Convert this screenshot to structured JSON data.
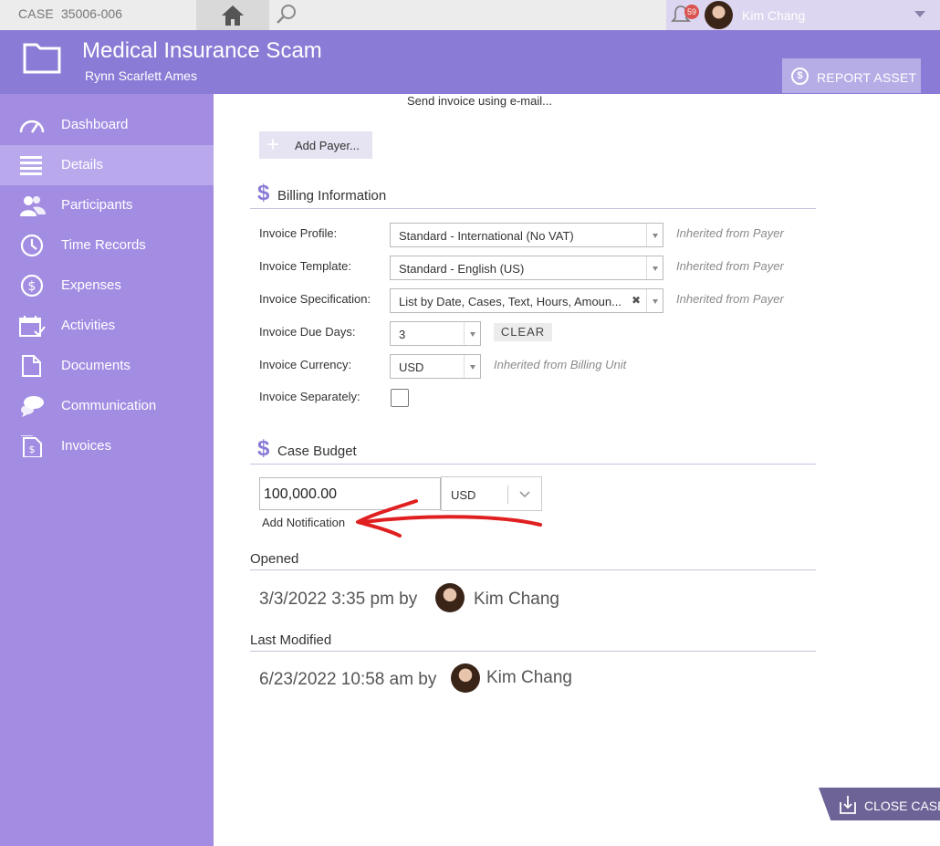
{
  "topbar": {
    "case_label": "CASE",
    "case_number": "35006-006",
    "notification_count": "59",
    "user_name": "Kim Chang"
  },
  "header": {
    "title": "Medical Insurance Scam",
    "subtitle": "Rynn Scarlett Ames",
    "report_asset_label": "REPORT ASSET"
  },
  "sidebar": {
    "items": [
      {
        "label": "Dashboard",
        "icon": "gauge-icon"
      },
      {
        "label": "Details",
        "icon": "list-icon",
        "active": true
      },
      {
        "label": "Participants",
        "icon": "people-icon"
      },
      {
        "label": "Time Records",
        "icon": "clock-icon"
      },
      {
        "label": "Expenses",
        "icon": "dollar-circle-icon"
      },
      {
        "label": "Activities",
        "icon": "calendar-icon"
      },
      {
        "label": "Documents",
        "icon": "document-icon"
      },
      {
        "label": "Communication",
        "icon": "chat-icon"
      },
      {
        "label": "Invoices",
        "icon": "invoice-icon"
      }
    ]
  },
  "content": {
    "send_invoice": "Send invoice using e-mail...",
    "add_payer": "Add Payer...",
    "billing": {
      "title": "Billing Information",
      "invoice_profile_label": "Invoice Profile:",
      "invoice_profile_value": "Standard - International (No VAT)",
      "invoice_profile_hint": "Inherited from Payer",
      "invoice_template_label": "Invoice Template:",
      "invoice_template_value": "Standard - English (US)",
      "invoice_template_hint": "Inherited from Payer",
      "invoice_spec_label": "Invoice Specification:",
      "invoice_spec_value": "List by Date, Cases, Text, Hours, Amoun...",
      "invoice_spec_hint": "Inherited from Payer",
      "due_days_label": "Invoice Due Days:",
      "due_days_value": "3",
      "clear_label": "CLEAR",
      "currency_label": "Invoice Currency:",
      "currency_value": "USD",
      "currency_hint": "Inherited from Billing Unit",
      "separately_label": "Invoice Separately:"
    },
    "budget": {
      "title": "Case Budget",
      "amount": "100,000.00",
      "currency": "USD",
      "add_notification": "Add Notification"
    },
    "opened": {
      "title": "Opened",
      "datetime": "3/3/2022 3:35 pm by",
      "user": "Kim Chang"
    },
    "modified": {
      "title": "Last Modified",
      "datetime": "6/23/2022 10:58 am by",
      "user": "Kim Chang"
    }
  },
  "footer": {
    "close_case_label": "CLOSE CASE"
  },
  "colors": {
    "header": "#8a7bd6",
    "sidebar": "#a38de3",
    "sidebar_active": "#b9a9ec",
    "annotation_arrow": "#e02020"
  }
}
